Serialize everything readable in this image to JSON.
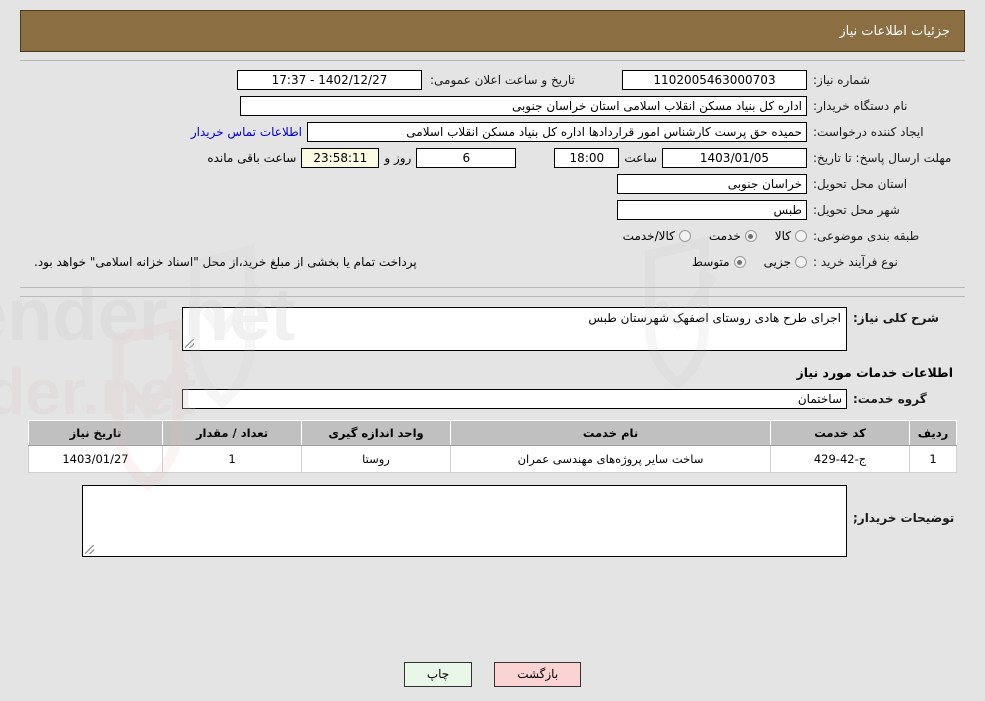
{
  "header": {
    "title": "جزئیات اطلاعات نیاز"
  },
  "form": {
    "need_number_label": "شماره نیاز:",
    "need_number_value": "1102005463000703",
    "announce_datetime_label": "تاریخ و ساعت اعلان عمومی:",
    "announce_datetime_value": "1402/12/27 - 17:37",
    "buyer_org_label": "نام دستگاه خریدار:",
    "buyer_org_value": "اداره کل بنیاد مسکن انقلاب اسلامی استان خراسان جنوبی",
    "creator_label": "ایجاد کننده درخواست:",
    "creator_value": "حمیده حق پرست کارشناس امور قراردادها اداره کل بنیاد مسکن انقلاب اسلامی",
    "contact_link": "اطلاعات تماس خریدار",
    "deadline_label": "مهلت ارسال پاسخ: تا تاریخ:",
    "deadline_date": "1403/01/05",
    "deadline_hour_label": "ساعت",
    "deadline_hour": "18:00",
    "remaining_days": "6",
    "days_and_label": "روز و",
    "remaining_time": "23:58:11",
    "remaining_suffix": "ساعت باقی مانده",
    "province_label": "استان محل تحویل:",
    "province_value": "خراسان جنوبی",
    "city_label": "شهر محل تحویل:",
    "city_value": "طبس",
    "category_label": "طبقه بندی موضوعی:",
    "category_options": [
      {
        "label": "کالا",
        "selected": false
      },
      {
        "label": "خدمت",
        "selected": true
      },
      {
        "label": "کالا/خدمت",
        "selected": false
      }
    ],
    "process_label": "نوع فرآیند خرید :",
    "process_options": [
      {
        "label": "جزیی",
        "selected": false
      },
      {
        "label": "متوسط",
        "selected": true
      }
    ],
    "payment_note": "پرداخت تمام یا بخشی از مبلغ خرید،از محل \"اسناد خزانه اسلامی\" خواهد بود."
  },
  "details": {
    "general_desc_label": "شرح کلی نیاز:",
    "general_desc_value": "اجرای طرح هادی روستای اصفهک شهرستان طبس",
    "services_section_title": "اطلاعات خدمات مورد نیاز",
    "service_group_label": "گروه خدمت:",
    "service_group_value": "ساختمان",
    "table": {
      "headers": [
        "ردیف",
        "کد خدمت",
        "نام خدمت",
        "واحد اندازه گیری",
        "تعداد / مقدار",
        "تاریخ نیاز"
      ],
      "rows": [
        {
          "index": "1",
          "code": "ج-42-429",
          "name": "ساخت سایر پروژه‌های مهندسی عمران",
          "unit": "روستا",
          "quantity": "1",
          "need_date": "1403/01/27"
        }
      ]
    },
    "buyer_notes_label": "توضیحات خریدار;",
    "buyer_notes_value": ""
  },
  "footer": {
    "print_label": "چاپ",
    "back_label": "بازگشت"
  },
  "colors": {
    "header_bg": "#8b6e42",
    "page_bg": "#e4e4e4",
    "link": "#0000cc",
    "table_header_bg": "#c0c0c0",
    "print_btn_bg": "#e9f7e9",
    "back_btn_bg": "#fbd3d3",
    "countdown_bg": "#fbfbe4"
  }
}
